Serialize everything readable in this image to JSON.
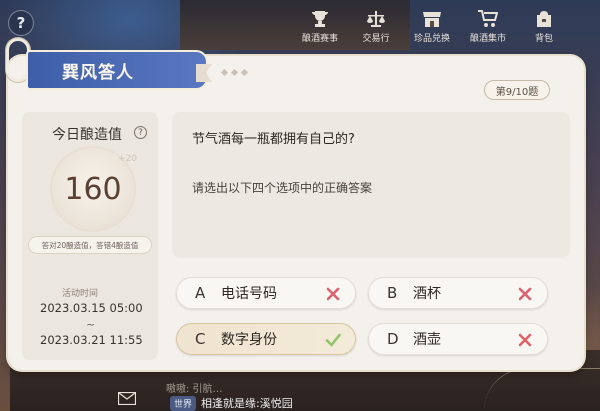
{
  "nav": {
    "items": [
      {
        "icon": "trophy-icon",
        "label": "酿酒赛事"
      },
      {
        "icon": "scales-icon",
        "label": "交易行"
      },
      {
        "icon": "shop-icon",
        "label": "珍品兑换"
      },
      {
        "icon": "cart-icon",
        "label": "酿酒集市"
      },
      {
        "icon": "bag-icon",
        "label": "背包"
      }
    ]
  },
  "card": {
    "title": "巽风答人",
    "question_counter": "第9/10题"
  },
  "daily": {
    "label": "今日酿造值",
    "help": "?",
    "score": "160",
    "plus_hint": "+20",
    "rule": "答对20酿造值，答错4酿造值"
  },
  "period": {
    "label": "活动时间",
    "start": "2023.03.15 05:00",
    "separator": "~",
    "end": "2023.03.21 11:55"
  },
  "question": {
    "text": "节气酒每一瓶都拥有自己的?",
    "instruction": "请选出以下四个选项中的正确答案"
  },
  "options": [
    {
      "letter": "A",
      "text": "电话号码",
      "result": "wrong"
    },
    {
      "letter": "B",
      "text": "酒杯",
      "result": "wrong"
    },
    {
      "letter": "C",
      "text": "数字身份",
      "result": "correct"
    },
    {
      "letter": "D",
      "text": "酒壶",
      "result": "wrong"
    }
  ],
  "chat": {
    "faded_line": "嗷嗷: 引航…",
    "channel": "世界",
    "message": "相逢就是缘:溪悦园"
  },
  "colors": {
    "banner": "#4a68b4",
    "correct": "#8fc46a",
    "wrong": "#e0606a",
    "card_bg": "#f4f1ed"
  }
}
